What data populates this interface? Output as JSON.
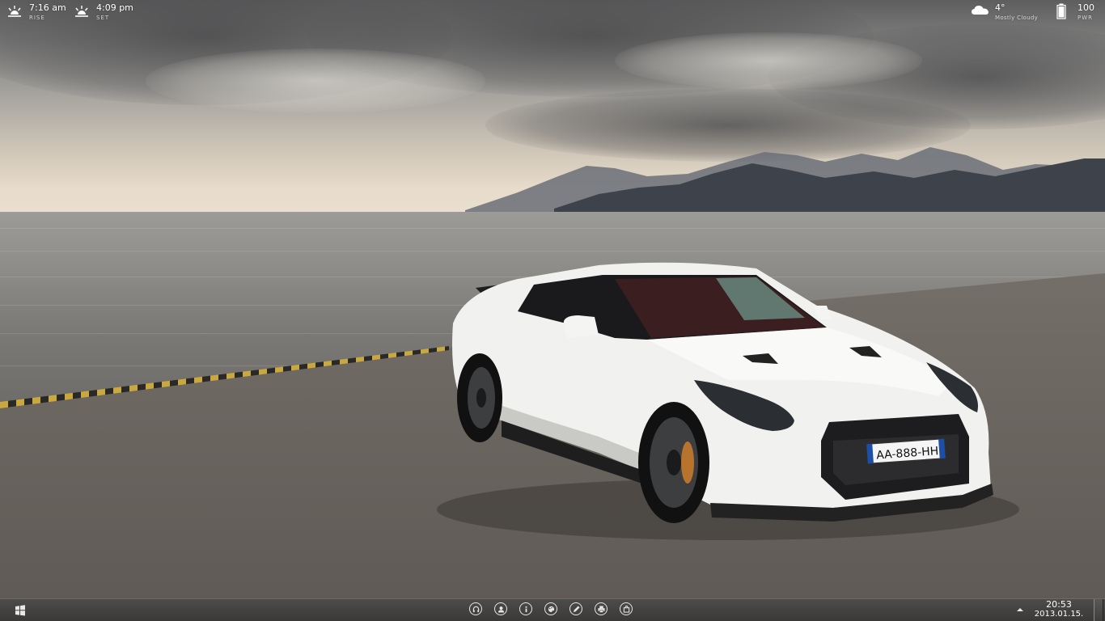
{
  "widgets": {
    "sunrise": {
      "time": "7:16 am",
      "label": "RISE",
      "icon": "sunrise-icon"
    },
    "sunset": {
      "time": "4:09 pm",
      "label": "SET",
      "icon": "sunset-icon"
    },
    "weather": {
      "temperature": "4°",
      "condition": "Mostly Cloudy",
      "icon": "cloud-icon"
    },
    "power": {
      "level": "100",
      "label": "PWR",
      "icon": "battery-icon"
    }
  },
  "wallpaper": {
    "license_plate": "AA-888-HH"
  },
  "taskbar": {
    "start_icon": "windows-logo-icon",
    "pinned": [
      {
        "name": "headphones-icon"
      },
      {
        "name": "user-icon"
      },
      {
        "name": "info-icon"
      },
      {
        "name": "palette-icon"
      },
      {
        "name": "pen-icon"
      },
      {
        "name": "printer-icon"
      },
      {
        "name": "bag-icon"
      }
    ],
    "tray_icon": "tray-up-arrow-icon",
    "clock": {
      "time": "20:53",
      "date": "2013.01.15."
    }
  },
  "colors": {
    "taskbar": "#403e3c",
    "widget_text": "#ffffff",
    "car_body": "#f1f1ef"
  }
}
